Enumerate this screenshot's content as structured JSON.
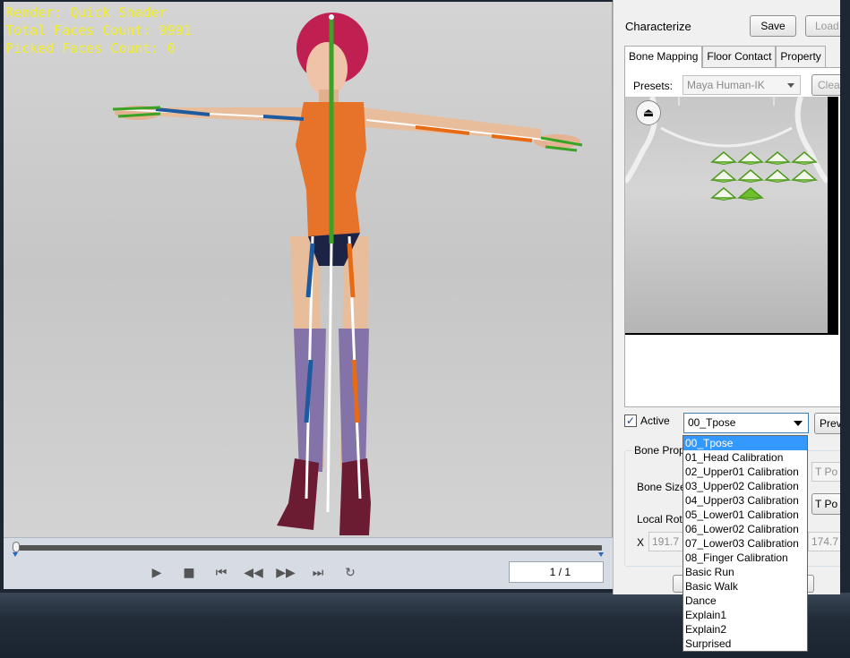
{
  "viewport": {
    "render_line": "Render: Quick Shader",
    "faces_line": "Total Faces Count: 9991",
    "picked_line": "Picked Faces Count: 0"
  },
  "timeline": {
    "frame_display": "1 / 1",
    "controls": [
      {
        "name": "play-icon",
        "glyph": "▶"
      },
      {
        "name": "stop-icon",
        "glyph": "■"
      },
      {
        "name": "go-start-icon",
        "glyph": "⏮"
      },
      {
        "name": "rewind-icon",
        "glyph": "◀◀"
      },
      {
        "name": "fast-forward-icon",
        "glyph": "▶▶"
      },
      {
        "name": "go-end-icon",
        "glyph": "⏭"
      },
      {
        "name": "loop-icon",
        "glyph": "↻"
      }
    ]
  },
  "panel": {
    "title": "Characterize",
    "save_label": "Save",
    "load_label": "Load",
    "tabs": [
      "Bone Mapping",
      "Floor Contact",
      "Property"
    ],
    "presets_label": "Presets:",
    "presets_value": "Maya Human-IK",
    "clear_label": "Clear",
    "active_label": "Active",
    "active_checked": true,
    "pose_value": "00_Tpose",
    "preview_label": "Preview",
    "bone_prop_label": "Bone Prop",
    "bone_size_label": "Bone Size",
    "local_rot_label": "Local Rot",
    "x_label": "X",
    "x_value": "191.7",
    "t_pose_a": "T Po",
    "t_pose_b": "T Po",
    "right_value": "174.7"
  },
  "dropdown": {
    "items": [
      "00_Tpose",
      "01_Head Calibration",
      "02_Upper01 Calibration",
      "03_Upper02 Calibration",
      "04_Upper03 Calibration",
      "05_Lower01 Calibration",
      "06_Lower02 Calibration",
      "07_Lower03 Calibration",
      "08_Finger Calibration",
      "Basic Run",
      "Basic Walk",
      "Dance",
      "Explain1",
      "Explain2",
      "Surprised"
    ],
    "selected_index": 0
  },
  "colors": {
    "stats_text": "#f0ef28",
    "selection": "#3399ff",
    "bone_marker": "#6fbe2b"
  }
}
